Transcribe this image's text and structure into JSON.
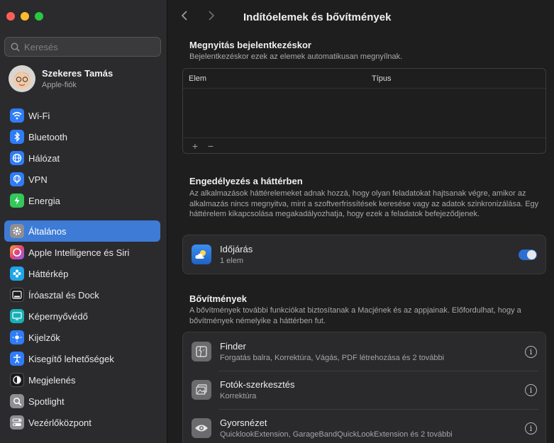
{
  "sidebar": {
    "search_placeholder": "Keresés",
    "account": {
      "name": "Szekeres Tamás",
      "subtitle": "Apple-fiók"
    },
    "group1": [
      {
        "label": "Wi-Fi",
        "icon": "wifi-icon",
        "color": "#2f7cf6"
      },
      {
        "label": "Bluetooth",
        "icon": "bluetooth-icon",
        "color": "#2f7cf6"
      },
      {
        "label": "Hálózat",
        "icon": "globe-icon",
        "color": "#2f7cf6"
      },
      {
        "label": "VPN",
        "icon": "vpn-globe-icon",
        "color": "#2f7cf6"
      },
      {
        "label": "Energia",
        "icon": "battery-bolt-icon",
        "color": "#34c759"
      }
    ],
    "group2": [
      {
        "label": "Általános",
        "icon": "gear-icon",
        "color": "#8e8e93",
        "selected": true
      },
      {
        "label": "Apple Intelligence és Siri",
        "icon": "siri-icon",
        "color": "#c65dd6"
      },
      {
        "label": "Háttérkép",
        "icon": "flower-icon",
        "color": "#1ea6e8"
      },
      {
        "label": "Íróasztal és Dock",
        "icon": "dock-icon",
        "color": "#1c1c1e"
      },
      {
        "label": "Képernyővédő",
        "icon": "screensaver-icon",
        "color": "#18b0b6"
      },
      {
        "label": "Kijelzők",
        "icon": "sun-icon",
        "color": "#2f7cf6"
      },
      {
        "label": "Kisegítő lehetőségek",
        "icon": "accessibility-icon",
        "color": "#2f7cf6"
      },
      {
        "label": "Megjelenés",
        "icon": "appearance-icon",
        "color": "#1c1c1e"
      },
      {
        "label": "Spotlight",
        "icon": "magnifier-icon",
        "color": "#8e8e93"
      },
      {
        "label": "Vezérlőközpont",
        "icon": "control-center-icon",
        "color": "#8e8e93"
      }
    ]
  },
  "main": {
    "title": "Indítóelemek és bővítmények",
    "login": {
      "title": "Megnyitás bejelentkezéskor",
      "desc": "Bejelentkezéskor ezek az elemek automatikusan megnyílnak.",
      "col_item": "Elem",
      "col_type": "Típus",
      "add": "+",
      "remove": "−"
    },
    "background": {
      "title": "Engedélyezés a háttérben",
      "desc": "Az alkalmazások háttérelemeket adnak hozzá, hogy olyan feladatokat hajtsanak végre, amikor az alkalmazás nincs megnyitva, mint a szoftverfrissítések keresése vagy az adatok szinkronizálása. Egy háttérelem kikapcsolása megakadályozhatja, hogy ezek a feladatok befejeződjenek.",
      "item": {
        "name": "Időjárás",
        "sub": "1 elem",
        "enabled": true
      }
    },
    "extensions": {
      "title": "Bővítmények",
      "desc": "A bővítmények további funkciókat biztosítanak a Macjének és az appjainak. Előfordulhat, hogy a bővítmények némelyike a háttérben fut.",
      "items": [
        {
          "name": "Finder",
          "sub": "Forgatás balra, Korrektúra, Vágás, PDF létrehozása és 2 további",
          "icon": "finder-icon"
        },
        {
          "name": "Fotók-szerkesztés",
          "sub": "Korrektúra",
          "icon": "photos-edit-icon"
        },
        {
          "name": "Gyorsnézet",
          "sub": "QuicklookExtension, GarageBandQuickLookExtension és 2 további",
          "icon": "eye-icon"
        }
      ],
      "info_glyph": "i"
    }
  }
}
